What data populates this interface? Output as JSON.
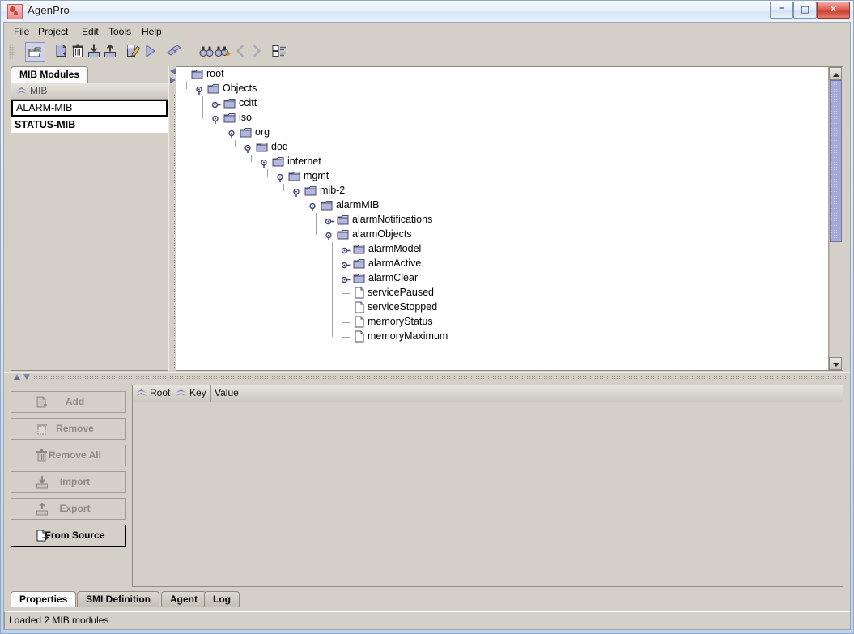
{
  "window": {
    "title": "AgenPro",
    "app_icon": "agenpro-icon",
    "controls": {
      "minimize": "–",
      "maximize": "□",
      "close": "✕"
    }
  },
  "menubar": {
    "items": [
      {
        "label": "File",
        "mnemonic": "F"
      },
      {
        "label": "Project",
        "mnemonic": "P"
      },
      {
        "label": "Edit",
        "mnemonic": "E"
      },
      {
        "label": "Tools",
        "mnemonic": "T"
      },
      {
        "label": "Help",
        "mnemonic": "H"
      }
    ]
  },
  "toolbar": {
    "buttons": [
      {
        "name": "open-folder-icon",
        "selected": true
      },
      {
        "name": "new-document-icon",
        "selected": false
      },
      {
        "name": "delete-trash-icon",
        "selected": false
      },
      {
        "name": "import-download-icon",
        "selected": false
      },
      {
        "name": "export-upload-icon",
        "selected": false
      },
      {
        "name": "edit-pencil-icon",
        "selected": false
      },
      {
        "name": "run-play-icon",
        "selected": false
      },
      {
        "name": "refresh-sync-icon",
        "selected": false
      },
      {
        "name": "find-binoculars-icon",
        "selected": false
      },
      {
        "name": "find-next-binoculars-icon",
        "selected": false
      },
      {
        "name": "back-arrow-icon",
        "selected": false
      },
      {
        "name": "forward-arrow-icon",
        "selected": false
      },
      {
        "name": "tree-list-view-icon",
        "selected": false
      }
    ]
  },
  "mib_panel": {
    "tab_label": "MIB Modules",
    "column_header": "MIB",
    "modules": [
      {
        "name": "ALARM-MIB",
        "selected": true,
        "bold": false
      },
      {
        "name": "STATUS-MIB",
        "selected": false,
        "bold": true
      }
    ]
  },
  "tree": {
    "nodes": [
      {
        "label": "root",
        "depth": 0,
        "type": "folder",
        "handle": "none"
      },
      {
        "label": "Objects",
        "depth": 1,
        "type": "folder",
        "handle": "expanded"
      },
      {
        "label": "ccitt",
        "depth": 2,
        "type": "folder",
        "handle": "collapsed"
      },
      {
        "label": "iso",
        "depth": 2,
        "type": "folder",
        "handle": "expanded"
      },
      {
        "label": "org",
        "depth": 3,
        "type": "folder",
        "handle": "expanded"
      },
      {
        "label": "dod",
        "depth": 4,
        "type": "folder",
        "handle": "expanded"
      },
      {
        "label": "internet",
        "depth": 5,
        "type": "folder",
        "handle": "expanded"
      },
      {
        "label": "mgmt",
        "depth": 6,
        "type": "folder",
        "handle": "expanded"
      },
      {
        "label": "mib-2",
        "depth": 7,
        "type": "folder",
        "handle": "expanded"
      },
      {
        "label": "alarmMIB",
        "depth": 8,
        "type": "folder",
        "handle": "expanded"
      },
      {
        "label": "alarmNotifications",
        "depth": 9,
        "type": "folder",
        "handle": "collapsed"
      },
      {
        "label": "alarmObjects",
        "depth": 9,
        "type": "folder",
        "handle": "expanded"
      },
      {
        "label": "alarmModel",
        "depth": 10,
        "type": "folder",
        "handle": "collapsed"
      },
      {
        "label": "alarmActive",
        "depth": 10,
        "type": "folder",
        "handle": "collapsed"
      },
      {
        "label": "alarmClear",
        "depth": 10,
        "type": "folder",
        "handle": "collapsed"
      },
      {
        "label": "servicePaused",
        "depth": 10,
        "type": "leaf",
        "handle": "none"
      },
      {
        "label": "serviceStopped",
        "depth": 10,
        "type": "leaf",
        "handle": "none"
      },
      {
        "label": "memoryStatus",
        "depth": 10,
        "type": "leaf",
        "handle": "none"
      },
      {
        "label": "memoryMaximum",
        "depth": 10,
        "type": "leaf",
        "handle": "none"
      }
    ]
  },
  "action_buttons": [
    {
      "label": "Add",
      "icon": "add-document-icon",
      "enabled": false
    },
    {
      "label": "Remove",
      "icon": "remove-trash-icon",
      "enabled": false
    },
    {
      "label": "Remove All",
      "icon": "trash-icon",
      "enabled": false
    },
    {
      "label": "Import",
      "icon": "import-icon",
      "enabled": false
    },
    {
      "label": "Export",
      "icon": "export-icon",
      "enabled": false
    },
    {
      "label": "From Source",
      "icon": "from-source-icon",
      "enabled": true
    }
  ],
  "properties_table": {
    "columns": [
      {
        "label": "Root",
        "sortable": true
      },
      {
        "label": "Key",
        "sortable": true
      },
      {
        "label": "Value",
        "sortable": false
      }
    ],
    "rows": []
  },
  "bottom_tabs": [
    {
      "label": "Properties",
      "active": true
    },
    {
      "label": "SMI Definition",
      "active": false
    },
    {
      "label": "Agent",
      "active": false
    },
    {
      "label": "Log",
      "active": false
    }
  ],
  "status_bar": {
    "text": "Loaded 2 MIB modules"
  },
  "colors": {
    "face": "#d4d0c8",
    "folder_icon": "#b0b4dc",
    "handle": "#4f5480",
    "scrollbar_thumb": "#a7a9d8",
    "close_button": "#c8392b"
  }
}
